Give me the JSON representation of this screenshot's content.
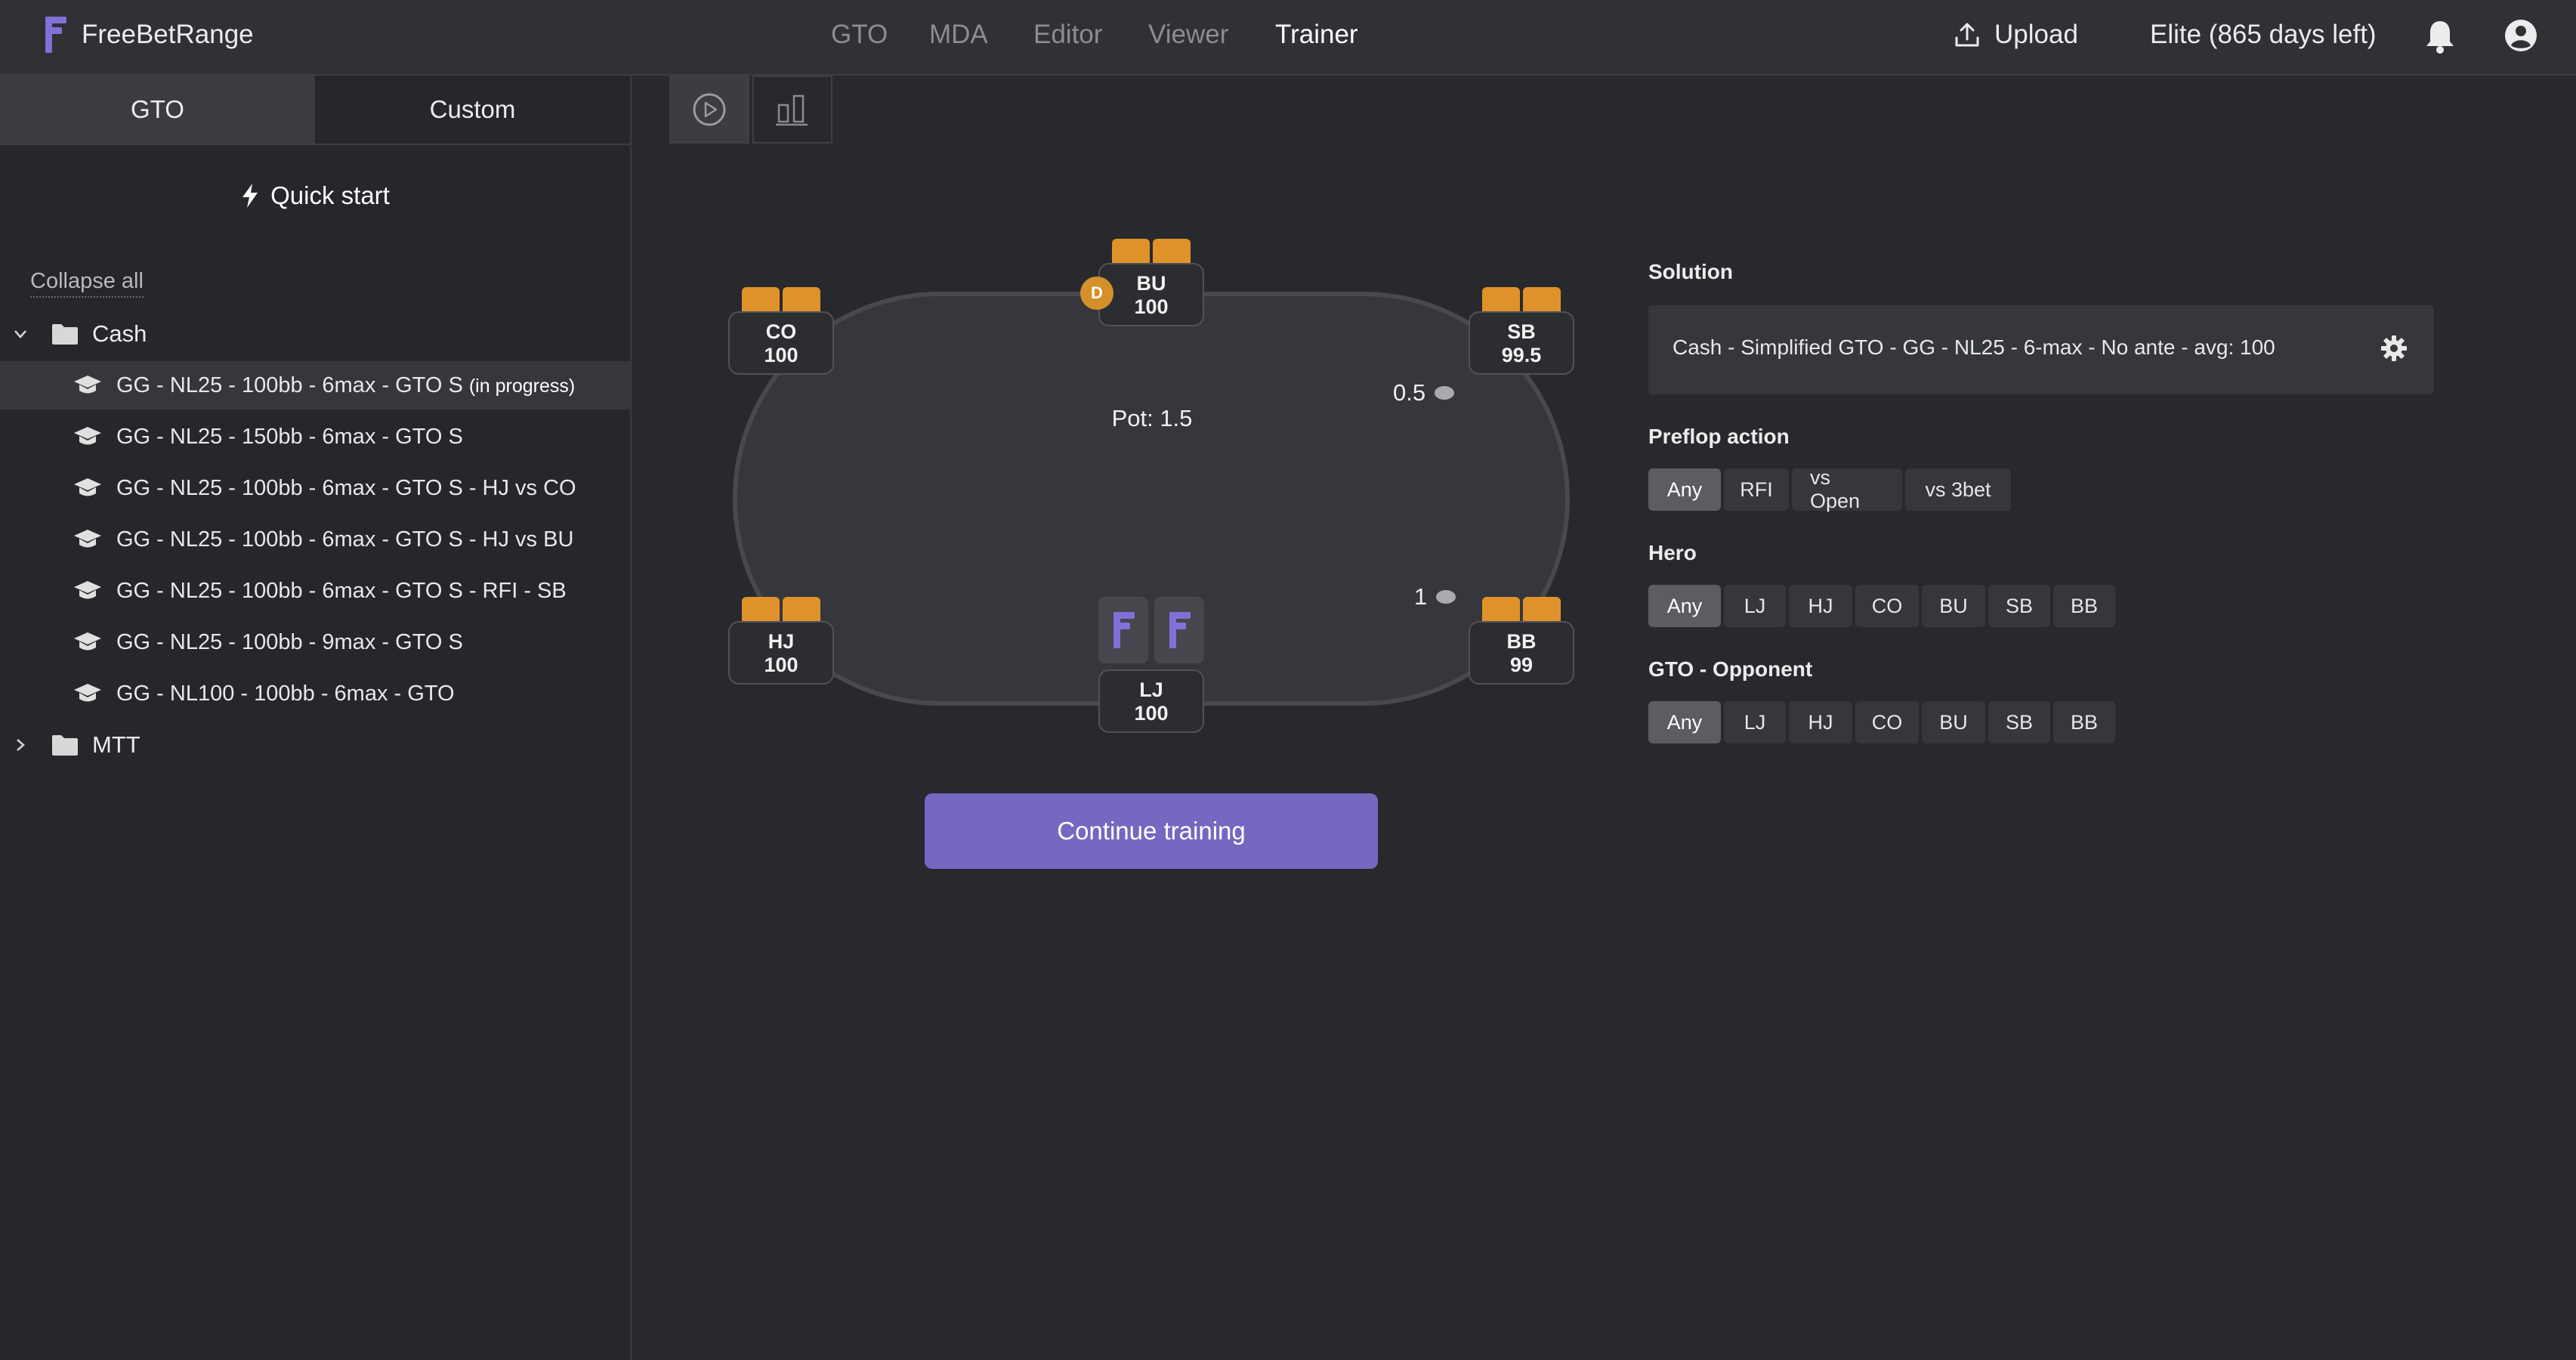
{
  "app": {
    "name": "FreeBetRange",
    "accent": "#7468c0",
    "card_color": "#e0922a"
  },
  "nav": {
    "items": [
      "GTO",
      "MDA",
      "Editor",
      "Viewer",
      "Trainer"
    ],
    "active": "Trainer"
  },
  "topbar": {
    "upload_label": "Upload",
    "plan_label": "Elite (865 days left)"
  },
  "sidebar": {
    "tabs": [
      "GTO",
      "Custom"
    ],
    "active_tab": "GTO",
    "quick_start": "Quick start",
    "collapse_all": "Collapse all",
    "folders": [
      {
        "label": "Cash",
        "expanded": true,
        "items": [
          {
            "label": "GG - NL25 - 100bb - 6max - GTO S",
            "status": "(in progress)",
            "selected": true
          },
          {
            "label": "GG - NL25 - 150bb - 6max - GTO S"
          },
          {
            "label": "GG - NL25 - 100bb - 6max - GTO S - HJ vs CO"
          },
          {
            "label": "GG - NL25 - 100bb - 6max - GTO S - HJ vs BU"
          },
          {
            "label": "GG - NL25 - 100bb - 6max - GTO S - RFI - SB"
          },
          {
            "label": "GG - NL25 - 100bb - 9max - GTO S"
          },
          {
            "label": "GG - NL100 - 100bb - 6max - GTO"
          }
        ]
      },
      {
        "label": "MTT",
        "expanded": false,
        "items": []
      }
    ]
  },
  "table": {
    "pot_label": "Pot: 1.5",
    "dealer_label": "D",
    "seats": {
      "bu": {
        "pos": "BU",
        "stack": "100"
      },
      "co": {
        "pos": "CO",
        "stack": "100"
      },
      "sb": {
        "pos": "SB",
        "stack": "99.5"
      },
      "hj": {
        "pos": "HJ",
        "stack": "100"
      },
      "bb": {
        "pos": "BB",
        "stack": "99"
      },
      "lj": {
        "pos": "LJ",
        "stack": "100"
      }
    },
    "bets": {
      "sb": "0.5",
      "bb": "1"
    }
  },
  "continue_label": "Continue training",
  "panel": {
    "solution_title": "Solution",
    "solution_value": "Cash - Simplified GTO - GG - NL25 - 6-max - No ante - avg: 100",
    "preflop_title": "Preflop action",
    "preflop_options": [
      "Any",
      "RFI",
      "vs Open",
      "vs 3bet"
    ],
    "preflop_selected": "Any",
    "hero_title": "Hero",
    "hero_options": [
      "Any",
      "LJ",
      "HJ",
      "CO",
      "BU",
      "SB",
      "BB"
    ],
    "hero_selected": "Any",
    "opponent_title": "GTO - Opponent",
    "opponent_options": [
      "Any",
      "LJ",
      "HJ",
      "CO",
      "BU",
      "SB",
      "BB"
    ],
    "opponent_selected": "Any"
  }
}
